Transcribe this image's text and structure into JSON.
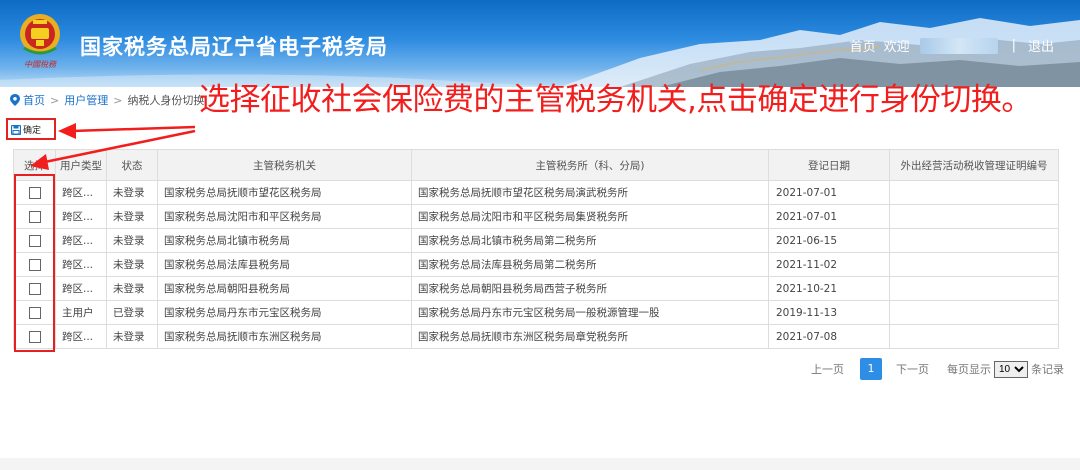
{
  "header": {
    "title": "国家税务总局辽宁省电子税务局",
    "home_link": "首页",
    "welcome": "欢迎",
    "separator": "|",
    "logout": "退出"
  },
  "breadcrumb": {
    "home": "首页",
    "user_mgmt": "用户管理",
    "current": "纳税人身份切换"
  },
  "annotation": "选择征收社会保险费的主管税务机关,点击确定进行身份切换。",
  "toolbar": {
    "confirm_label": "确定"
  },
  "table": {
    "headers": [
      "选择",
      "用户类型",
      "状态",
      "主管税务机关",
      "主管税务所（科、分局)",
      "登记日期",
      "外出经营活动税收管理证明编号"
    ],
    "rows": [
      {
        "type": "跨区...",
        "status": "未登录",
        "authority": "国家税务总局抚顺市望花区税务局",
        "office": "国家税务总局抚顺市望花区税务局演武税务所",
        "date": "2021-07-01",
        "cert": ""
      },
      {
        "type": "跨区...",
        "status": "未登录",
        "authority": "国家税务总局沈阳市和平区税务局",
        "office": "国家税务总局沈阳市和平区税务局集贤税务所",
        "date": "2021-07-01",
        "cert": ""
      },
      {
        "type": "跨区...",
        "status": "未登录",
        "authority": "国家税务总局北镇市税务局",
        "office": "国家税务总局北镇市税务局第二税务所",
        "date": "2021-06-15",
        "cert": ""
      },
      {
        "type": "跨区...",
        "status": "未登录",
        "authority": "国家税务总局法库县税务局",
        "office": "国家税务总局法库县税务局第二税务所",
        "date": "2021-11-02",
        "cert": ""
      },
      {
        "type": "跨区...",
        "status": "未登录",
        "authority": "国家税务总局朝阳县税务局",
        "office": "国家税务总局朝阳县税务局西营子税务所",
        "date": "2021-10-21",
        "cert": ""
      },
      {
        "type": "主用户",
        "status": "已登录",
        "authority": "国家税务总局丹东市元宝区税务局",
        "office": "国家税务总局丹东市元宝区税务局一般税源管理一股",
        "date": "2019-11-13",
        "cert": ""
      },
      {
        "type": "跨区...",
        "status": "未登录",
        "authority": "国家税务总局抚顺市东洲区税务局",
        "office": "国家税务总局抚顺市东洲区税务局章党税务所",
        "date": "2021-07-08",
        "cert": ""
      }
    ]
  },
  "pager": {
    "prev": "上一页",
    "current_page": "1",
    "next": "下一页",
    "per_page_label": "每页显示",
    "per_page_value": "10",
    "records_label": "条记录"
  },
  "colors": {
    "accent": "#2e8ee5",
    "annotation": "#f21d1d",
    "header_blue": "#0d6bc4"
  }
}
